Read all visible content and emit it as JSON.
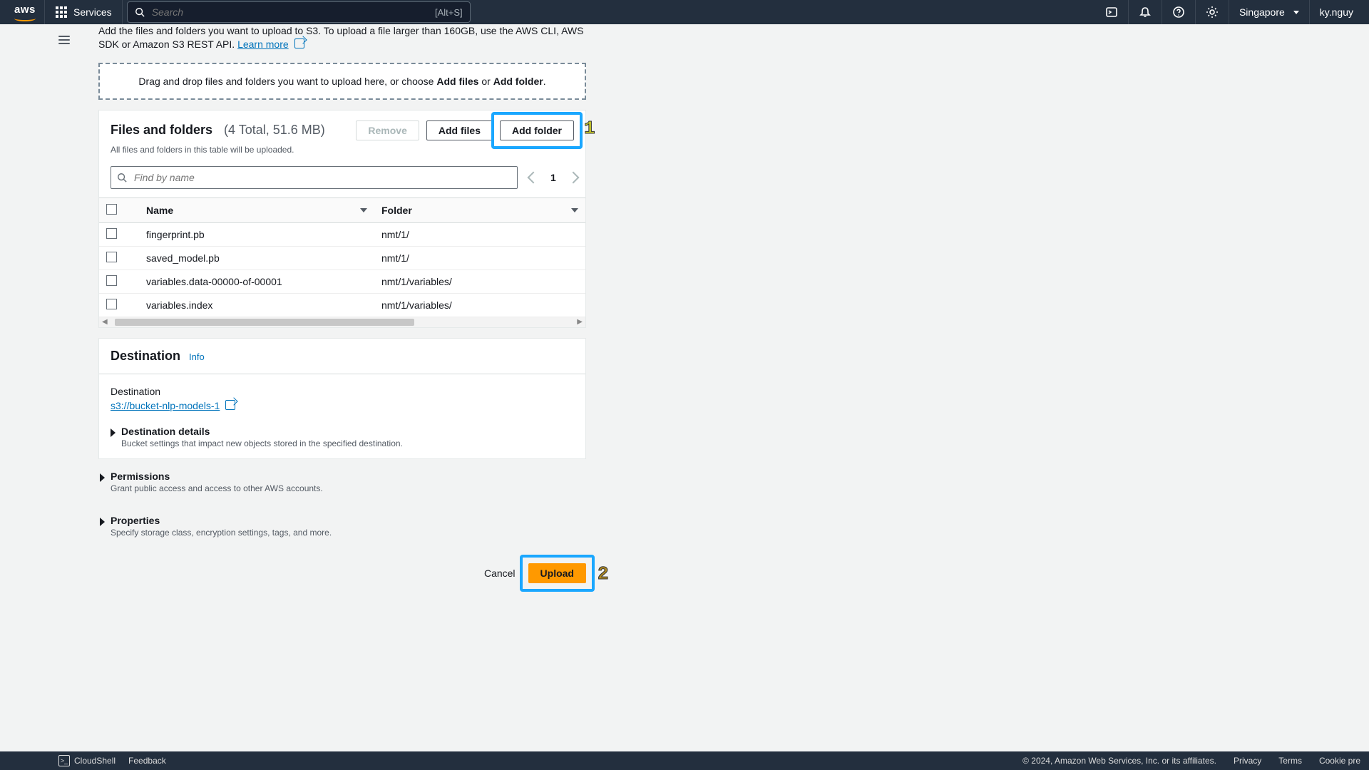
{
  "nav": {
    "services": "Services",
    "search_placeholder": "Search",
    "search_kbd": "[Alt+S]",
    "region": "Singapore",
    "user": "ky.nguy"
  },
  "intro": {
    "text_a": "Add the files and folders you want to upload to S3. To upload a file larger than 160GB, use the AWS CLI, AWS SDK or Amazon S3 REST API. ",
    "learn_more": "Learn more"
  },
  "dropzone": {
    "pre": "Drag and drop files and folders you want to upload here, or choose ",
    "add_files": "Add files",
    "or": " or ",
    "add_folder": "Add folder",
    "post": "."
  },
  "files_card": {
    "title": "Files and folders",
    "count_text": "(4 Total, 51.6 MB)",
    "subtext": "All files and folders in this table will be uploaded.",
    "btn_remove": "Remove",
    "btn_add_files": "Add files",
    "btn_add_folder": "Add folder",
    "filter_placeholder": "Find by name",
    "page": "1",
    "columns": {
      "name": "Name",
      "folder": "Folder"
    },
    "rows": [
      {
        "name": "fingerprint.pb",
        "folder": "nmt/1/"
      },
      {
        "name": "saved_model.pb",
        "folder": "nmt/1/"
      },
      {
        "name": "variables.data-00000-of-00001",
        "folder": "nmt/1/variables/"
      },
      {
        "name": "variables.index",
        "folder": "nmt/1/variables/"
      }
    ]
  },
  "destination": {
    "title": "Destination",
    "info": "Info",
    "label": "Destination",
    "uri": "s3://bucket-nlp-models-1",
    "details_title": "Destination details",
    "details_sub": "Bucket settings that impact new objects stored in the specified destination."
  },
  "permissions": {
    "title": "Permissions",
    "sub": "Grant public access and access to other AWS accounts."
  },
  "properties": {
    "title": "Properties",
    "sub": "Specify storage class, encryption settings, tags, and more."
  },
  "actions": {
    "cancel": "Cancel",
    "upload": "Upload"
  },
  "footer": {
    "cloudshell": "CloudShell",
    "feedback": "Feedback",
    "copyright": "© 2024, Amazon Web Services, Inc. or its affiliates.",
    "privacy": "Privacy",
    "terms": "Terms",
    "cookie": "Cookie pre"
  },
  "annotations": {
    "one": "1",
    "two": "2"
  }
}
